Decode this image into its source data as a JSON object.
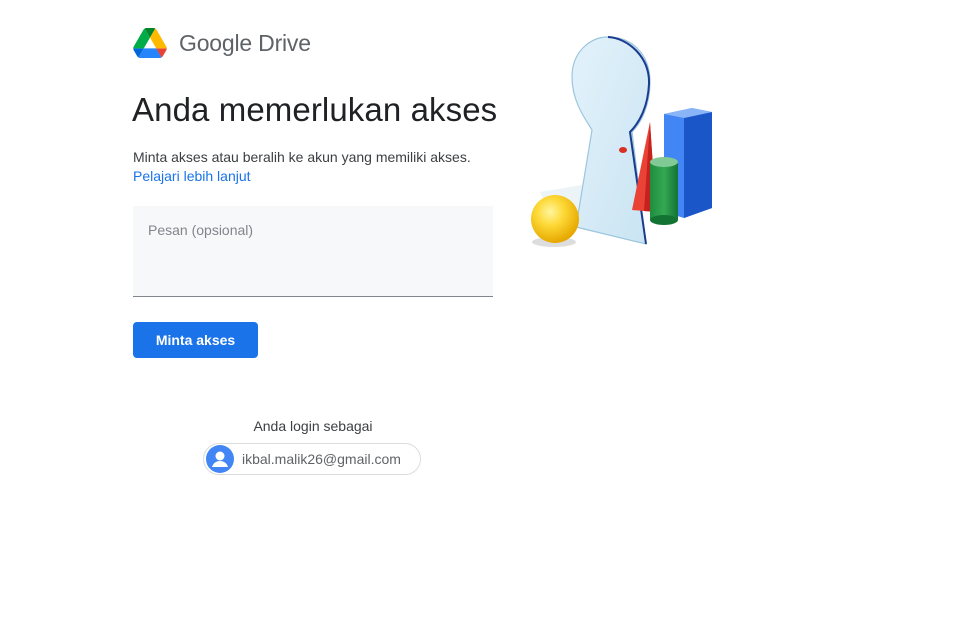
{
  "header": {
    "logo_icon": "google-drive-logo",
    "brand_text": "Google Drive"
  },
  "main": {
    "title": "Anda memerlukan akses",
    "description": "Minta akses atau beralih ke akun yang memiliki akses.",
    "learn_more_label": "Pelajari lebih lanjut",
    "message_placeholder": "Pesan (opsional)",
    "message_value": "",
    "request_button_label": "Minta akses"
  },
  "account": {
    "login_label": "Anda login sebagai",
    "email": "ikbal.malik26@gmail.com",
    "avatar_icon": "person-avatar-icon"
  },
  "colors": {
    "accent": "#1a73e8",
    "avatar_bg": "#4285f4",
    "drive_green": "#0f9d58",
    "drive_yellow": "#f4b400",
    "drive_blue": "#4285f4"
  }
}
